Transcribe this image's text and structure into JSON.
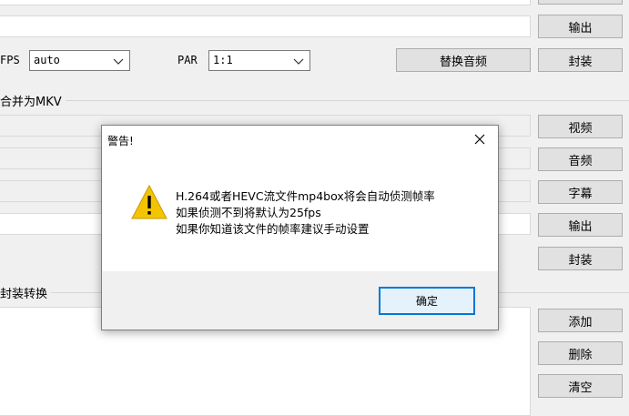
{
  "top": {
    "output_button": "输出",
    "mux_button": "封装",
    "fps_label": "FPS",
    "fps_value": "auto",
    "par_label": "PAR",
    "par_value": "1:1",
    "replace_audio_button": "替换音频"
  },
  "mkv_section": {
    "title": "合并为MKV",
    "video_button": "视频",
    "audio_button": "音频",
    "subtitle_button": "字幕",
    "output_button": "输出",
    "mux_button": "封装"
  },
  "convert_section": {
    "title": "封装转换",
    "add_button": "添加",
    "delete_button": "删除",
    "clear_button": "清空"
  },
  "dialog": {
    "title": "警告!",
    "lines": [
      "H.264或者HEVC流文件mp4box将会自动侦测帧率",
      "如果侦测不到将默认为25fps",
      "如果你知道该文件的帧率建议手动设置"
    ],
    "ok_button": "确定"
  },
  "colors": {
    "accent": "#0078d7",
    "warning": "#f5c400"
  }
}
